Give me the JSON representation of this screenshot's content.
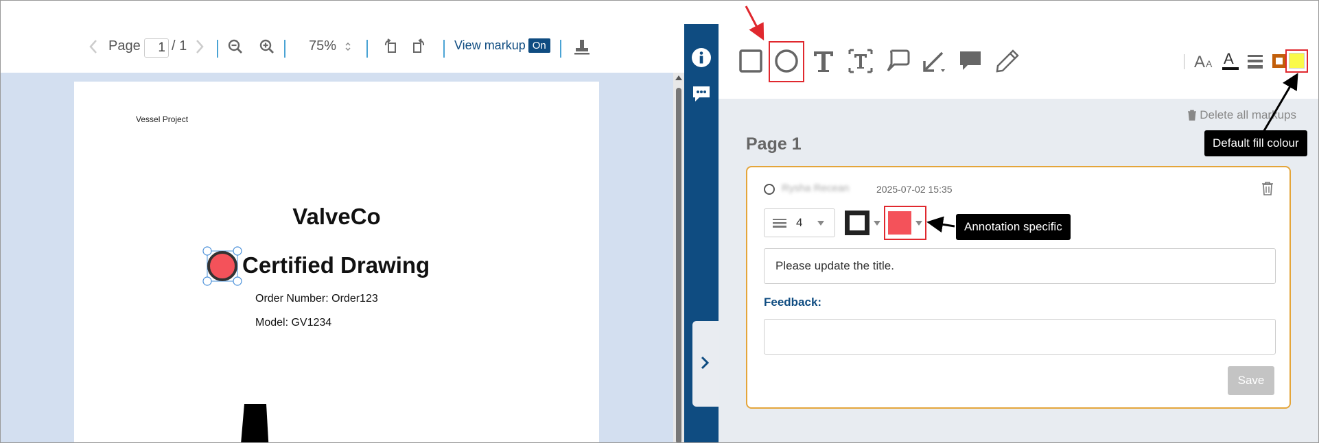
{
  "viewer": {
    "page_label": "Page",
    "page_current": "1",
    "page_total": "/ 1",
    "zoom": "75%",
    "view_markup_label": "View markup",
    "view_markup_state": "On"
  },
  "document": {
    "header": "Vessel Project",
    "company": "ValveCo",
    "title": "Certified Drawing",
    "order": "Order Number: Order123",
    "model": "Model: GV1234"
  },
  "markup_panel": {
    "delete_all": "Delete all markups",
    "page_heading": "Page 1",
    "card": {
      "author": "Rysha Recean",
      "timestamp": "2025-07-02 15:35",
      "line_width": "4",
      "stroke_color": "#222222",
      "fill_color": "#f4525a",
      "comment_value": "Please update the title.",
      "feedback_label": "Feedback:",
      "feedback_value": "",
      "save_label": "Save"
    }
  },
  "toolbar": {
    "tools": [
      "rectangle-icon",
      "ellipse-icon",
      "text-icon",
      "text-box-icon",
      "callout-icon",
      "arrow-icon",
      "comment-icon",
      "pencil-icon"
    ],
    "default_stroke_color": "#c25f0b",
    "default_fill_color": "#fafa4a"
  },
  "annotations": {
    "default_fill": "Default fill colour",
    "annotation_specific": "Annotation specific"
  },
  "colors": {
    "brand": "#0f4c81",
    "highlight": "#e0282e",
    "card_border": "#e4a53a",
    "canvas_bg": "#d3dff0"
  }
}
